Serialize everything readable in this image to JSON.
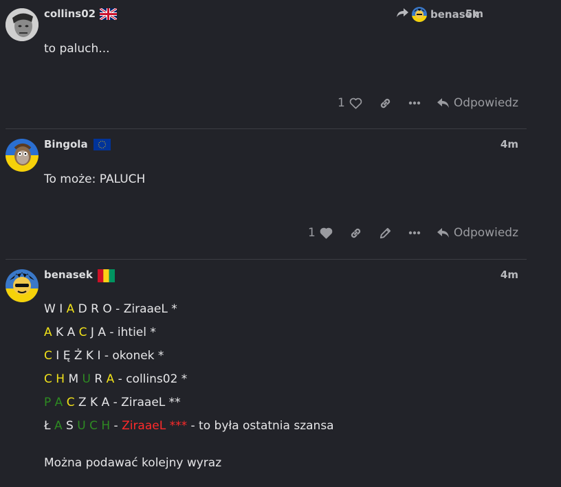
{
  "posts": [
    {
      "username": "collins02",
      "flag": "uk-flag",
      "reply_to": "benasek",
      "time": "5m",
      "text": "to paluch...",
      "likes": "1",
      "reply_label": "Odpowiedz"
    },
    {
      "username": "Bingola",
      "flag": "eu-flag",
      "time": "4m",
      "text": "To może: PALUCH",
      "likes": "1",
      "reply_label": "Odpowiedz"
    },
    {
      "username": "benasek",
      "flag": "guinea-flag",
      "time": "4m",
      "lines": [
        {
          "segments": [
            {
              "t": "W I ",
              "c": "w"
            },
            {
              "t": "A",
              "c": "y"
            },
            {
              "t": " D R O - ZiraaeL *",
              "c": "w"
            }
          ]
        },
        {
          "segments": [
            {
              "t": "A",
              "c": "y"
            },
            {
              "t": " K A ",
              "c": "w"
            },
            {
              "t": "C",
              "c": "y"
            },
            {
              "t": " J A - ihtiel *",
              "c": "w"
            }
          ]
        },
        {
          "segments": [
            {
              "t": "C",
              "c": "y"
            },
            {
              "t": " I Ę Ż K I - okonek *",
              "c": "w"
            }
          ]
        },
        {
          "segments": [
            {
              "t": "C H",
              "c": "y"
            },
            {
              "t": " M ",
              "c": "w"
            },
            {
              "t": "U",
              "c": "g"
            },
            {
              "t": " R ",
              "c": "w"
            },
            {
              "t": "A",
              "c": "y"
            },
            {
              "t": " - collins02 *",
              "c": "w"
            }
          ]
        },
        {
          "segments": [
            {
              "t": "P A",
              "c": "g"
            },
            {
              "t": " ",
              "c": "w"
            },
            {
              "t": "C",
              "c": "y"
            },
            {
              "t": " Z K A - ZiraaeL **",
              "c": "w"
            }
          ]
        },
        {
          "segments": [
            {
              "t": "Ł ",
              "c": "w"
            },
            {
              "t": "A",
              "c": "g"
            },
            {
              "t": " S ",
              "c": "w"
            },
            {
              "t": "U C H",
              "c": "g"
            },
            {
              "t": " - ",
              "c": "w"
            },
            {
              "t": "ZiraaeL ***",
              "c": "r"
            },
            {
              "t": " - to była ostatnia szansa",
              "c": "w"
            }
          ]
        }
      ],
      "footer_text": "Można podawać kolejny wyraz"
    }
  ],
  "colors": {
    "yellow": "#f1e21a",
    "green": "#2e8b22",
    "red": "#ff2a2a",
    "background": "#222329"
  }
}
